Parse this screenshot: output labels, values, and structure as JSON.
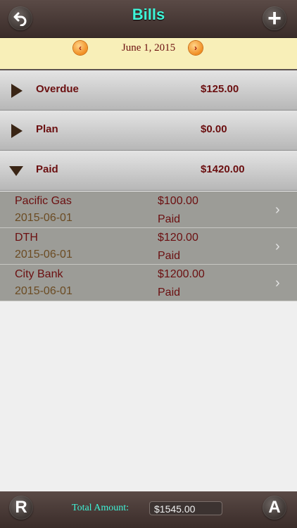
{
  "header": {
    "title": "Bills",
    "back_icon": "undo-arrow-icon",
    "add_label": "+"
  },
  "date_bar": {
    "date": "June 1, 2015",
    "prev_label": "‹",
    "next_label": "›"
  },
  "groups": [
    {
      "label": "Overdue",
      "amount": "$125.00",
      "expanded": false
    },
    {
      "label": "Plan",
      "amount": "$0.00",
      "expanded": false
    },
    {
      "label": "Paid",
      "amount": "$1420.00",
      "expanded": true
    }
  ],
  "paid_items": [
    {
      "name": "Pacific Gas",
      "date": "2015-06-01",
      "amount": "$100.00",
      "status": "Paid"
    },
    {
      "name": "DTH",
      "date": "2015-06-01",
      "amount": "$120.00",
      "status": "Paid"
    },
    {
      "name": "City Bank",
      "date": "2015-06-01",
      "amount": "$1200.00",
      "status": "Paid"
    }
  ],
  "footer": {
    "r_label": "R",
    "a_label": "A",
    "total_label": "Total Amount:",
    "total_value": "$1545.00"
  },
  "colors": {
    "title": "#3ef5d8",
    "text_dark_red": "#6b0f10",
    "date_bar_bg": "#f8efb8"
  }
}
